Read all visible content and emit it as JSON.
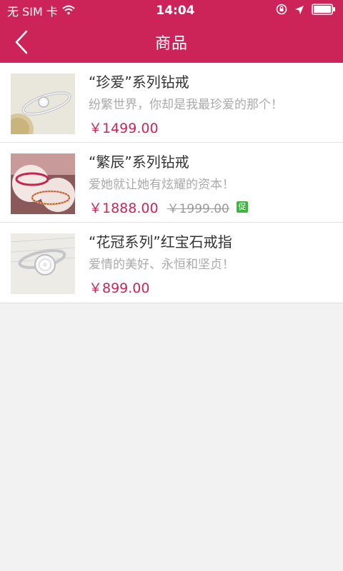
{
  "status_bar": {
    "carrier": "无 SIM 卡",
    "time": "14:04",
    "icons": [
      "wifi-icon",
      "rotation-lock-icon",
      "location-arrow-icon",
      "battery-icon"
    ]
  },
  "nav": {
    "title": "商品",
    "back_icon": "chevron-left-icon"
  },
  "colors": {
    "brand": "#cc2458",
    "promo": "#3fb53f",
    "background": "#f2f2f2"
  },
  "products": [
    {
      "title": "“珍爱”系列钻戒",
      "description": "纷繁世界，你却是我最珍爱的那个！",
      "price": "￥1499.00"
    },
    {
      "title": "“繁辰”系列钻戒",
      "description": "爱她就让她有炫耀的资本！",
      "price": "￥1888.00",
      "old_price": "￥1999.00",
      "promo_badge": "促"
    },
    {
      "title": "“花冠系列”红宝石戒指",
      "description": "爱情的美好、永恒和坚贞！",
      "price": "￥899.00"
    }
  ]
}
